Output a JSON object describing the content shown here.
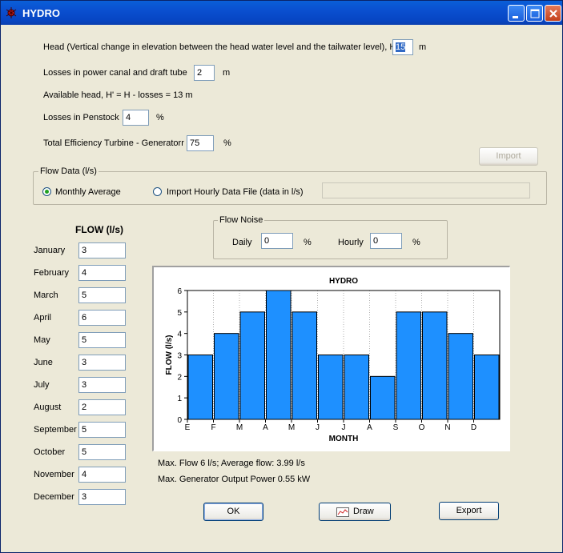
{
  "window": {
    "title": "HYDRO",
    "minimize_label": "minimize",
    "maximize_label": "maximize",
    "close_label": "close"
  },
  "inputs": {
    "head_label": "Head (Vertical change in elevation between the head water level and the tailwater level), H:",
    "head_value": "15",
    "head_unit": "m",
    "losses_canal_label": "Losses in power canal and draft tube",
    "losses_canal_value": "2",
    "losses_canal_unit": "m",
    "available_head_text": "Available head, H' = H - losses =  13 m",
    "losses_penstock_label": "Losses in Penstock",
    "losses_penstock_value": "4",
    "losses_penstock_unit": "%",
    "efficiency_label": "Total Efficiency Turbine - Generatorr",
    "efficiency_value": "75",
    "efficiency_unit": "%"
  },
  "import_button": "Import",
  "flow_data": {
    "group_label": "Flow Data (l/s)",
    "monthly_average_label": "Monthly Average",
    "hourly_file_label": "Import Hourly Data File (data in l/s)",
    "hourly_file_value": "",
    "selected": "monthly_average"
  },
  "flow_noise": {
    "group_label": "Flow Noise",
    "daily_label": "Daily",
    "daily_value": "0",
    "daily_unit": "%",
    "hourly_label": "Hourly",
    "hourly_value": "0",
    "hourly_unit": "%"
  },
  "flow_table": {
    "header": "FLOW (l/s)",
    "months": [
      {
        "name": "January",
        "value": "3"
      },
      {
        "name": "February",
        "value": "4"
      },
      {
        "name": "March",
        "value": "5"
      },
      {
        "name": "April",
        "value": "6"
      },
      {
        "name": "May",
        "value": "5"
      },
      {
        "name": "June",
        "value": "3"
      },
      {
        "name": "July",
        "value": "3"
      },
      {
        "name": "August",
        "value": "2"
      },
      {
        "name": "September",
        "value": "5"
      },
      {
        "name": "October",
        "value": "5"
      },
      {
        "name": "November",
        "value": "4"
      },
      {
        "name": "December",
        "value": "3"
      }
    ]
  },
  "chart_data": {
    "type": "bar",
    "title": "HYDRO",
    "xlabel": "MONTH",
    "ylabel": "FLOW (l/s)",
    "categories": [
      "E",
      "F",
      "M",
      "A",
      "M",
      "J",
      "J",
      "A",
      "S",
      "O",
      "N",
      "D"
    ],
    "values": [
      3,
      4,
      5,
      6,
      5,
      3,
      3,
      2,
      5,
      5,
      4,
      3
    ],
    "ylim": [
      0,
      6
    ],
    "yticks": [
      0,
      1,
      2,
      3,
      4,
      5,
      6
    ],
    "bar_color": "#1e90ff",
    "grid": true
  },
  "summary": {
    "max_flow_text": "Max. Flow  6 l/s; Average flow: 3.99 l/s",
    "max_power_text": "Max. Generator Output Power  0.55 kW"
  },
  "buttons": {
    "ok": "OK",
    "draw": "Draw",
    "export": "Export"
  }
}
